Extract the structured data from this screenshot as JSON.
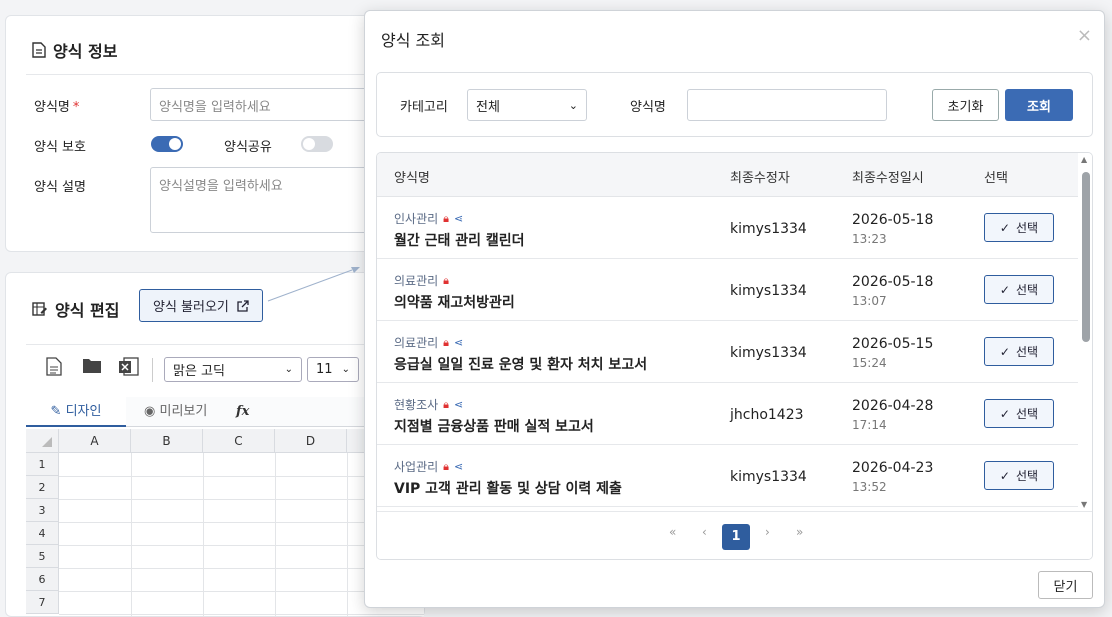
{
  "form_info": {
    "title": "양식 정보",
    "name_label": "양식명",
    "name_required_mark": "*",
    "name_placeholder": "양식명을 입력하세요",
    "protect_label": "양식 보호",
    "protect_on": true,
    "share_label": "양식공유",
    "share_on": false,
    "desc_label": "양식 설명",
    "desc_placeholder": "양식설명을 입력하세요"
  },
  "form_edit": {
    "title": "양식 편집",
    "load_button": "양식 불러오기",
    "font_select": "맑은 고딕",
    "size_select": "11",
    "tab_design": "디자인",
    "tab_preview": "미리보기",
    "fx": "fx",
    "columns": [
      "A",
      "B",
      "C",
      "D"
    ],
    "rows": [
      "1",
      "2",
      "3",
      "4",
      "5",
      "6",
      "7"
    ]
  },
  "modal": {
    "title": "양식 조회",
    "close_glyph": "×",
    "category_label": "카테고리",
    "category_value": "전체",
    "name_label": "양식명",
    "name_value": "",
    "reset_button": "초기화",
    "search_button": "조회",
    "headers": {
      "name": "양식명",
      "modifier": "최종수정자",
      "modified_at": "최종수정일시",
      "select": "선택"
    },
    "select_label": "선택",
    "rows": [
      {
        "category": "인사관리",
        "locked": true,
        "shared": true,
        "name": "월간 근태 관리 캘린더",
        "user": "kimys1334",
        "date": "2026-05-18",
        "time": "13:23"
      },
      {
        "category": "의료관리",
        "locked": true,
        "shared": false,
        "name": "의약품 재고처방관리",
        "user": "kimys1334",
        "date": "2026-05-18",
        "time": "13:07"
      },
      {
        "category": "의료관리",
        "locked": true,
        "shared": true,
        "name": "응급실 일일 진료 운영 및 환자 처치 보고서",
        "user": "kimys1334",
        "date": "2026-05-15",
        "time": "15:24"
      },
      {
        "category": "현황조사",
        "locked": true,
        "shared": true,
        "name": "지점별 금융상품 판매 실적 보고서",
        "user": "jhcho1423",
        "date": "2026-04-28",
        "time": "17:14"
      },
      {
        "category": "사업관리",
        "locked": true,
        "shared": true,
        "name": "VIP 고객 관리 활동 및 상담 이력 제출",
        "user": "kimys1334",
        "date": "2026-04-23",
        "time": "13:52"
      }
    ],
    "pager": {
      "first": "«",
      "prev": "‹",
      "current": "1",
      "next": "›",
      "last": "»"
    },
    "close_button": "닫기"
  },
  "colors": {
    "accent": "#3b6bb4",
    "required": "#e03131"
  }
}
